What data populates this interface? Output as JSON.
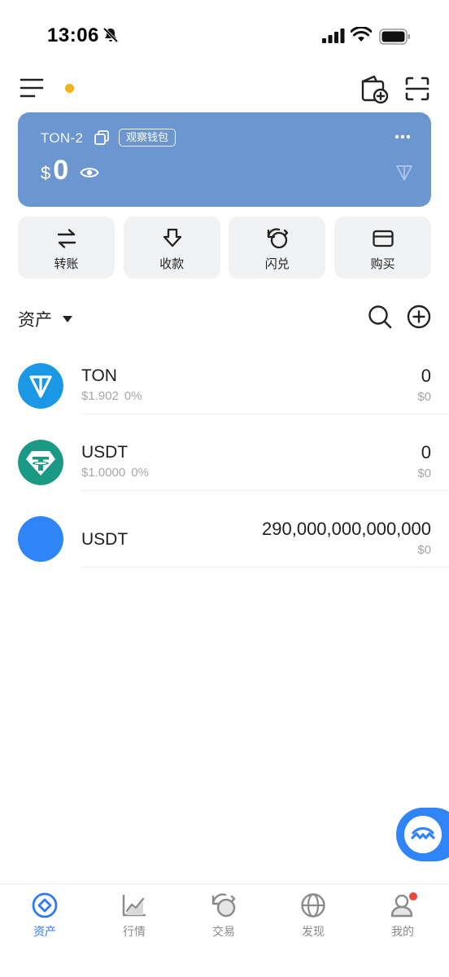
{
  "status_bar": {
    "time": "13:06"
  },
  "wallet": {
    "name": "TON-2",
    "badge": "观察钱包",
    "currency_symbol": "$",
    "balance": "0",
    "card_color": "#6c96cf"
  },
  "actions": [
    {
      "label": "转账",
      "icon": "transfer-icon"
    },
    {
      "label": "收款",
      "icon": "receive-icon"
    },
    {
      "label": "闪兑",
      "icon": "swap-icon"
    },
    {
      "label": "购买",
      "icon": "card-icon"
    }
  ],
  "assets": {
    "title": "资产",
    "items": [
      {
        "name": "TON",
        "price": "$1.902",
        "change": "0%",
        "amount": "0",
        "value": "$0",
        "icon": "ton-logo",
        "color": "#1a98e6"
      },
      {
        "name": "USDT",
        "price": "$1.0000",
        "change": "0%",
        "amount": "0",
        "value": "$0",
        "icon": "tether-logo",
        "color": "#1a9a84"
      },
      {
        "name": "USDT",
        "price": "",
        "change": "",
        "amount": "290,000,000,000,000",
        "value": "$0",
        "icon": "blue-circle-logo",
        "color": "#2f84f6"
      }
    ]
  },
  "nav": [
    {
      "label": "资产",
      "icon": "assets-icon",
      "active": true
    },
    {
      "label": "行情",
      "icon": "market-icon",
      "active": false
    },
    {
      "label": "交易",
      "icon": "trade-icon",
      "active": false
    },
    {
      "label": "发现",
      "icon": "discover-icon",
      "active": false
    },
    {
      "label": "我的",
      "icon": "profile-icon",
      "active": false
    }
  ],
  "colors": {
    "accent": "#2f7bf0",
    "notify_dot": "#f2b01e",
    "badge_red": "#e8483f"
  }
}
